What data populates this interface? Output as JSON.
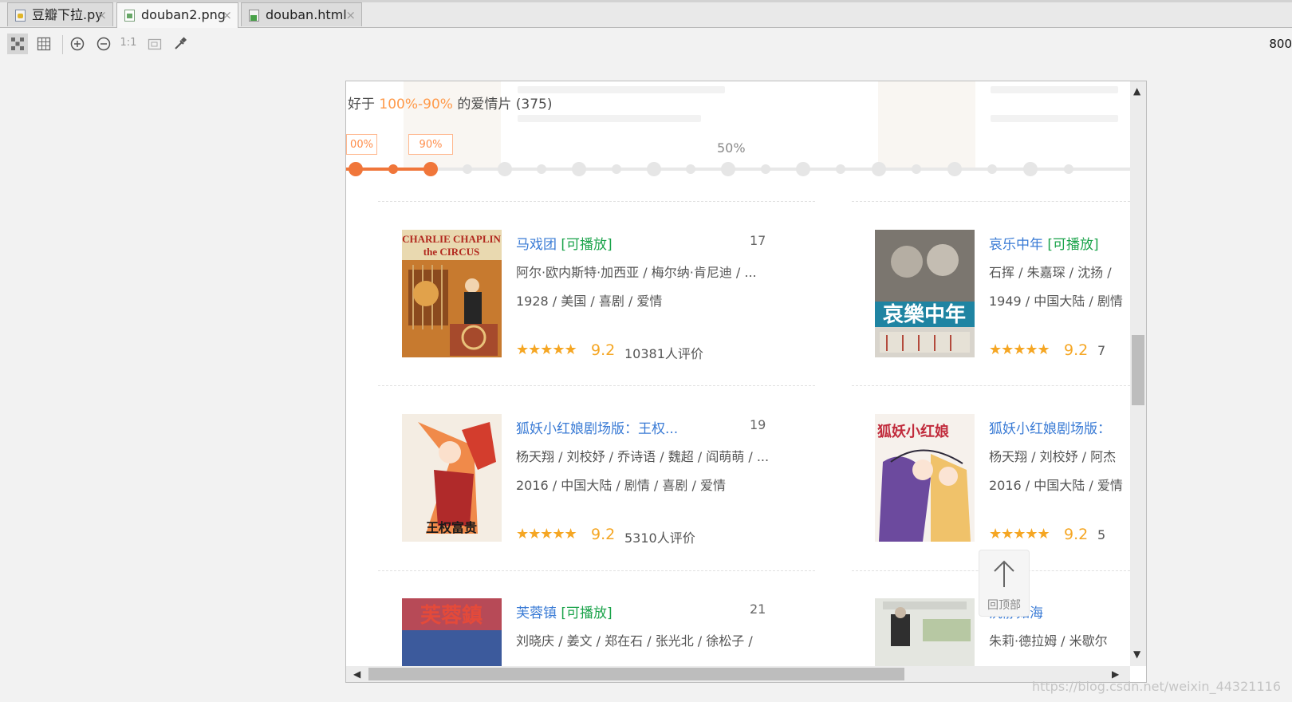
{
  "tabs": [
    {
      "label": "豆瓣下拉.py",
      "icon": "python-file-icon"
    },
    {
      "label": "douban2.png",
      "icon": "image-file-icon"
    },
    {
      "label": "douban.html",
      "icon": "html-file-icon"
    }
  ],
  "toolbar": {
    "actual_size_label": "1:1",
    "zoom_value": "800"
  },
  "filter": {
    "prefix": "好于 ",
    "range": "100%-90%",
    "suffix": " 的爱情片 (375)",
    "left_tip": "00%",
    "handle_tip": "90%",
    "mid_label": "50%"
  },
  "movies": [
    {
      "title": "马戏团",
      "playable": "[可播放]",
      "rank": "17",
      "cast": "阿尔·欧内斯特·加西亚 / 梅尔纳·肯尼迪 / ...",
      "meta": "1928 / 美国 / 喜剧 / 爱情",
      "stars": "★★★★★",
      "score": "9.2",
      "votes": "10381人评价",
      "poster_text": "CHARLIE CHAPLIN"
    },
    {
      "title": "哀乐中年",
      "playable": "[可播放]",
      "rank": "",
      "cast": "石挥 / 朱嘉琛 / 沈扬 /",
      "meta": "1949 / 中国大陆 / 剧情",
      "stars": "★★★★★",
      "score": "9.2",
      "votes": "7",
      "poster_text": "哀樂中年"
    },
    {
      "title": "狐妖小红娘剧场版：王权...",
      "playable": "",
      "rank": "19",
      "cast": "杨天翔 / 刘校妤 / 乔诗语 / 魏超 / 阎萌萌 / ...",
      "meta": "2016 / 中国大陆 / 剧情 / 喜剧 / 爱情",
      "stars": "★★★★★",
      "score": "9.2",
      "votes": "5310人评价",
      "poster_text": "王权富贵"
    },
    {
      "title": "狐妖小红娘剧场版：",
      "playable": "",
      "rank": "",
      "cast": "杨天翔 / 刘校妤 / 阿杰",
      "meta": "2016 / 中国大陆 / 爱情",
      "stars": "★★★★★",
      "score": "9.2",
      "votes": "5",
      "poster_text": "狐妖小红娘"
    },
    {
      "title": "芙蓉镇",
      "playable": "[可播放]",
      "rank": "21",
      "cast": "刘晓庆 / 姜文 / 郑在石 / 张光北 / 徐松子 /",
      "meta": "",
      "stars": "",
      "score": "",
      "votes": "",
      "poster_text": "芙蓉鎮"
    },
    {
      "title": "沉静如海",
      "playable": "",
      "rank": "",
      "cast": "朱莉·德拉姆 / 米歇尔",
      "meta": "",
      "stars": "",
      "score": "",
      "votes": "",
      "poster_text": ""
    }
  ],
  "back_to_top": "回顶部",
  "watermark": "https://blog.csdn.net/weixin_44321116",
  "colors": {
    "link": "#3a7bd5",
    "playable": "#1aa34a",
    "rating": "#f5a623",
    "accent": "#f0763a"
  }
}
